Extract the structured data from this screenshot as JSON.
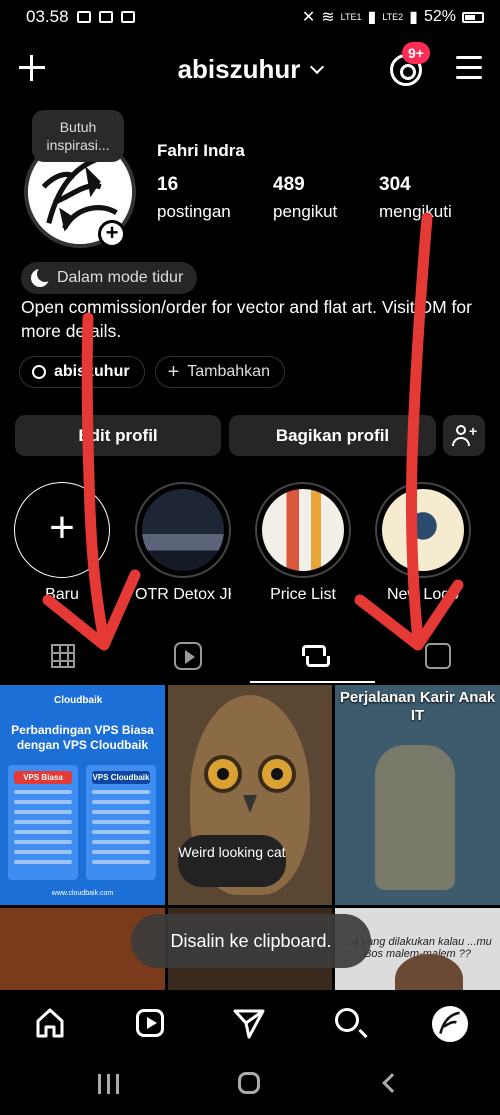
{
  "status_bar": {
    "time": "03.58",
    "battery": "52%",
    "net1": "LTE1",
    "net2": "LTE2"
  },
  "header": {
    "username": "abiszuhur",
    "notification_badge": "9+"
  },
  "profile": {
    "inspiration_prompt": "Butuh inspirasi...",
    "name": "Fahri Indra",
    "posts_count": "16",
    "posts_label": "postingan",
    "followers_count": "489",
    "followers_label": "pengikut",
    "following_count": "304",
    "following_label": "mengikuti",
    "sleep_mode": "Dalam mode tidur",
    "bio": "Open commission/order for vector and flat art. Visit DM for more details.",
    "threads_chip": "abiszuhur",
    "add_chip": "Tambahkan"
  },
  "actions": {
    "edit_profile": "Edit profil",
    "share_profile": "Bagikan profil"
  },
  "highlights": [
    {
      "label": "Baru"
    },
    {
      "label": "OTR Detox JK..."
    },
    {
      "label": "Price List"
    },
    {
      "label": "New Logo"
    }
  ],
  "tabs": [
    "grid",
    "reels",
    "reposts",
    "tagged"
  ],
  "active_tab": "reposts",
  "posts": {
    "p1_brand": "Cloudbaik",
    "p1_title": "Perbandingan VPS Biasa dengan VPS Cloudbaik",
    "p1_col1": "VPS Biasa",
    "p1_col2": "VPS Cloudbaik",
    "p1_footer": "www.cloudbaik.com",
    "p2_caption": "Weird looking cat",
    "p3_title": "Perjalanan Karir Anak IT",
    "p6_text": "...a yang dilakukan kalau ...mu Bos malem-malem ??"
  },
  "toast": "Disalin ke clipboard.",
  "colors": {
    "background": "#000000",
    "button_bg": "#262626",
    "badge": "#ff2d55",
    "annotation_red": "#e53935"
  }
}
